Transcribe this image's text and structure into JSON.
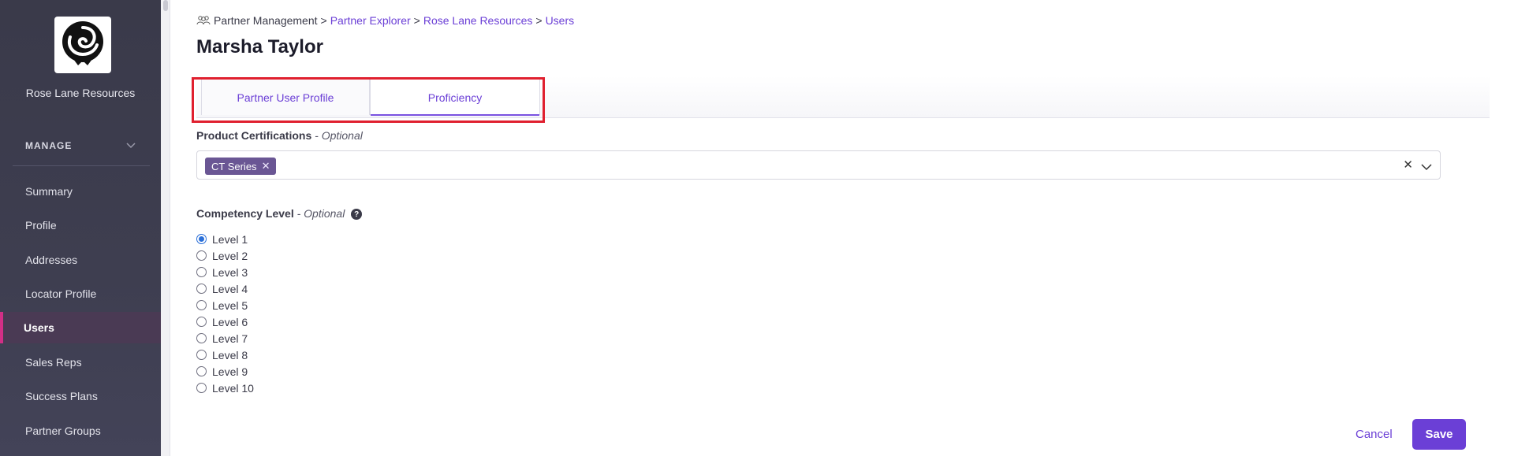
{
  "sidebar": {
    "org_name": "Rose Lane Resources",
    "section_label": "MANAGE",
    "items": [
      {
        "label": "Summary"
      },
      {
        "label": "Profile"
      },
      {
        "label": "Addresses"
      },
      {
        "label": "Locator Profile"
      },
      {
        "label": "Users",
        "active": true
      },
      {
        "label": "Sales Reps"
      },
      {
        "label": "Success Plans"
      },
      {
        "label": "Partner Groups"
      }
    ]
  },
  "breadcrumb": {
    "root": "Partner Management",
    "sep": ">",
    "items": [
      "Partner Explorer",
      "Rose Lane Resources",
      "Users"
    ]
  },
  "page": {
    "title": "Marsha Taylor"
  },
  "tabs": [
    {
      "label": "Partner User Profile"
    },
    {
      "label": "Proficiency",
      "active": true
    }
  ],
  "certifications": {
    "label": "Product Certifications",
    "optional": "- Optional",
    "chips": [
      "CT Series"
    ]
  },
  "competency": {
    "label": "Competency Level",
    "optional": "- Optional",
    "selected": "Level 1",
    "options": [
      "Level 1",
      "Level 2",
      "Level 3",
      "Level 4",
      "Level 5",
      "Level 6",
      "Level 7",
      "Level 8",
      "Level 9",
      "Level 10"
    ]
  },
  "actions": {
    "cancel": "Cancel",
    "save": "Save"
  },
  "colors": {
    "accent": "#6b3fd6",
    "sidebar": "#3e3e50",
    "active_marker": "#d22f86",
    "highlight": "#e0202f",
    "chip": "#6a5694"
  }
}
